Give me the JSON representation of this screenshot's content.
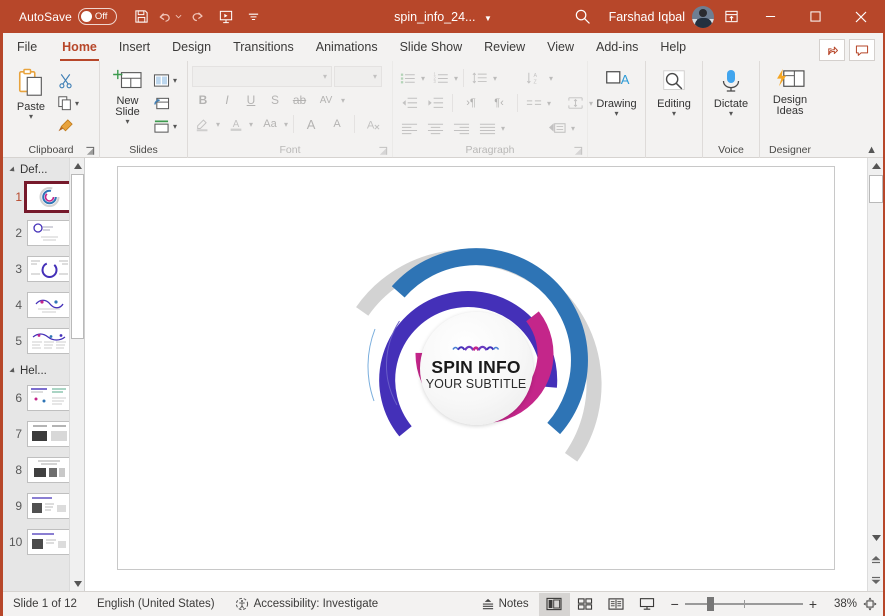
{
  "titlebar": {
    "autosave_label": "AutoSave",
    "autosave_state": "Off",
    "doc_title": "spin_info_24...",
    "user_name": "Farshad Iqbal",
    "quick_access": [
      "save-icon",
      "undo-icon",
      "redo-icon",
      "start-presentation-icon",
      "customize-qat-icon"
    ],
    "window_buttons": [
      "minimize",
      "maximize",
      "close"
    ],
    "accent_color": "#B7472A"
  },
  "tabs": [
    {
      "label": "File",
      "active": false
    },
    {
      "label": "Home",
      "active": true
    },
    {
      "label": "Insert",
      "active": false
    },
    {
      "label": "Design",
      "active": false
    },
    {
      "label": "Transitions",
      "active": false
    },
    {
      "label": "Animations",
      "active": false
    },
    {
      "label": "Slide Show",
      "active": false
    },
    {
      "label": "Review",
      "active": false
    },
    {
      "label": "View",
      "active": false
    },
    {
      "label": "Add-ins",
      "active": false
    },
    {
      "label": "Help",
      "active": false
    }
  ],
  "tab_right": {
    "share": "share-icon",
    "comments": "comment-icon"
  },
  "ribbon": {
    "groups": [
      {
        "label": "Clipboard",
        "has_launcher": true
      },
      {
        "label": "Slides",
        "has_launcher": false
      },
      {
        "label": "Font",
        "has_launcher": true
      },
      {
        "label": "Paragraph",
        "has_launcher": true
      },
      {
        "label": "Voice",
        "has_launcher": false
      },
      {
        "label": "Designer",
        "has_launcher": false
      }
    ],
    "clipboard": {
      "paste_label": "Paste",
      "cut_name": "cut-icon",
      "copy_name": "copy-icon",
      "format_painter_name": "format-painter-icon"
    },
    "slides": {
      "new_slide_label": "New Slide",
      "layout_name": "layout-icon",
      "reset_name": "reset-icon",
      "section_name": "section-icon"
    },
    "font": {
      "font_name_value": "",
      "font_size_value": "",
      "bold": "B",
      "italic": "I",
      "underline": "U",
      "shadow": "S",
      "strikethrough": "ab",
      "char_spacing": "AV",
      "highlight": "text-highlight-icon",
      "font_color": "font-color-icon",
      "change_case": "Aa",
      "grow_font": "A",
      "shrink_font": "A",
      "clear_formatting": "clear-formatting-icon",
      "disabled": true
    },
    "paragraph": {
      "bullets": "bullets-icon",
      "numbering": "numbering-icon",
      "line_spacing": "line-spacing-icon",
      "text_direction": "text-direction-icon",
      "decrease_indent": "decrease-indent-icon",
      "increase_indent": "increase-indent-icon",
      "ltr": "ltr-icon",
      "rtl": "rtl-icon",
      "columns": "columns-icon",
      "align_text": "align-text-icon",
      "align_left": "align-left-icon",
      "align_center": "align-center-icon",
      "align_right": "align-right-icon",
      "justify": "justify-icon",
      "smartart": "smartart-icon",
      "disabled": true
    },
    "drawing_label": "Drawing",
    "editing_label": "Editing",
    "dictate_label": "Dictate",
    "design_ideas_label": "Design Ideas",
    "collapse_icon": "chevron-up-icon"
  },
  "thumbnails": {
    "sections": [
      {
        "name": "Def...",
        "first": 1,
        "count": 5
      },
      {
        "name": "Hel...",
        "first": 6,
        "count": 5
      }
    ],
    "slides": [
      {
        "number": "1",
        "selected": true
      },
      {
        "number": "2",
        "selected": false
      },
      {
        "number": "3",
        "selected": false
      },
      {
        "number": "4",
        "selected": false
      },
      {
        "number": "5",
        "selected": false
      },
      {
        "number": "6",
        "selected": false
      },
      {
        "number": "7",
        "selected": false
      },
      {
        "number": "8",
        "selected": false
      },
      {
        "number": "9",
        "selected": false
      },
      {
        "number": "10",
        "selected": false
      }
    ]
  },
  "slide": {
    "hub_title": "SPIN INFO",
    "hub_subtitle": "YOUR SUBTITLE",
    "colors": {
      "grey": "#D3D3D3",
      "blue": "#2E74B5",
      "purple": "#4430B8",
      "magenta": "#C4268A"
    },
    "rings": [
      {
        "name": "outer-grey-ring",
        "color": "#D3D3D3",
        "start_deg": 150,
        "sweep_deg": 290
      },
      {
        "name": "blue-ring",
        "color": "#2E74B5",
        "start_deg": 300,
        "sweep_deg": 280
      },
      {
        "name": "purple-ring",
        "color": "#4430B8",
        "start_deg": 295,
        "sweep_deg": 175
      },
      {
        "name": "magenta-ring",
        "color": "#C4268A",
        "start_deg": 320,
        "sweep_deg": 195
      }
    ]
  },
  "statusbar": {
    "slide_counter": "Slide 1 of 12",
    "language": "English (United States)",
    "accessibility": "Accessibility: Investigate",
    "notes_label": "Notes",
    "views": [
      {
        "name": "normal-view",
        "active": true
      },
      {
        "name": "slide-sorter-view",
        "active": false
      },
      {
        "name": "reading-view",
        "active": false
      },
      {
        "name": "slide-show-view",
        "active": false
      }
    ],
    "zoom_out": "−",
    "zoom_in": "+",
    "zoom_level": "38%",
    "fit_slide": "fit-to-window-icon"
  }
}
